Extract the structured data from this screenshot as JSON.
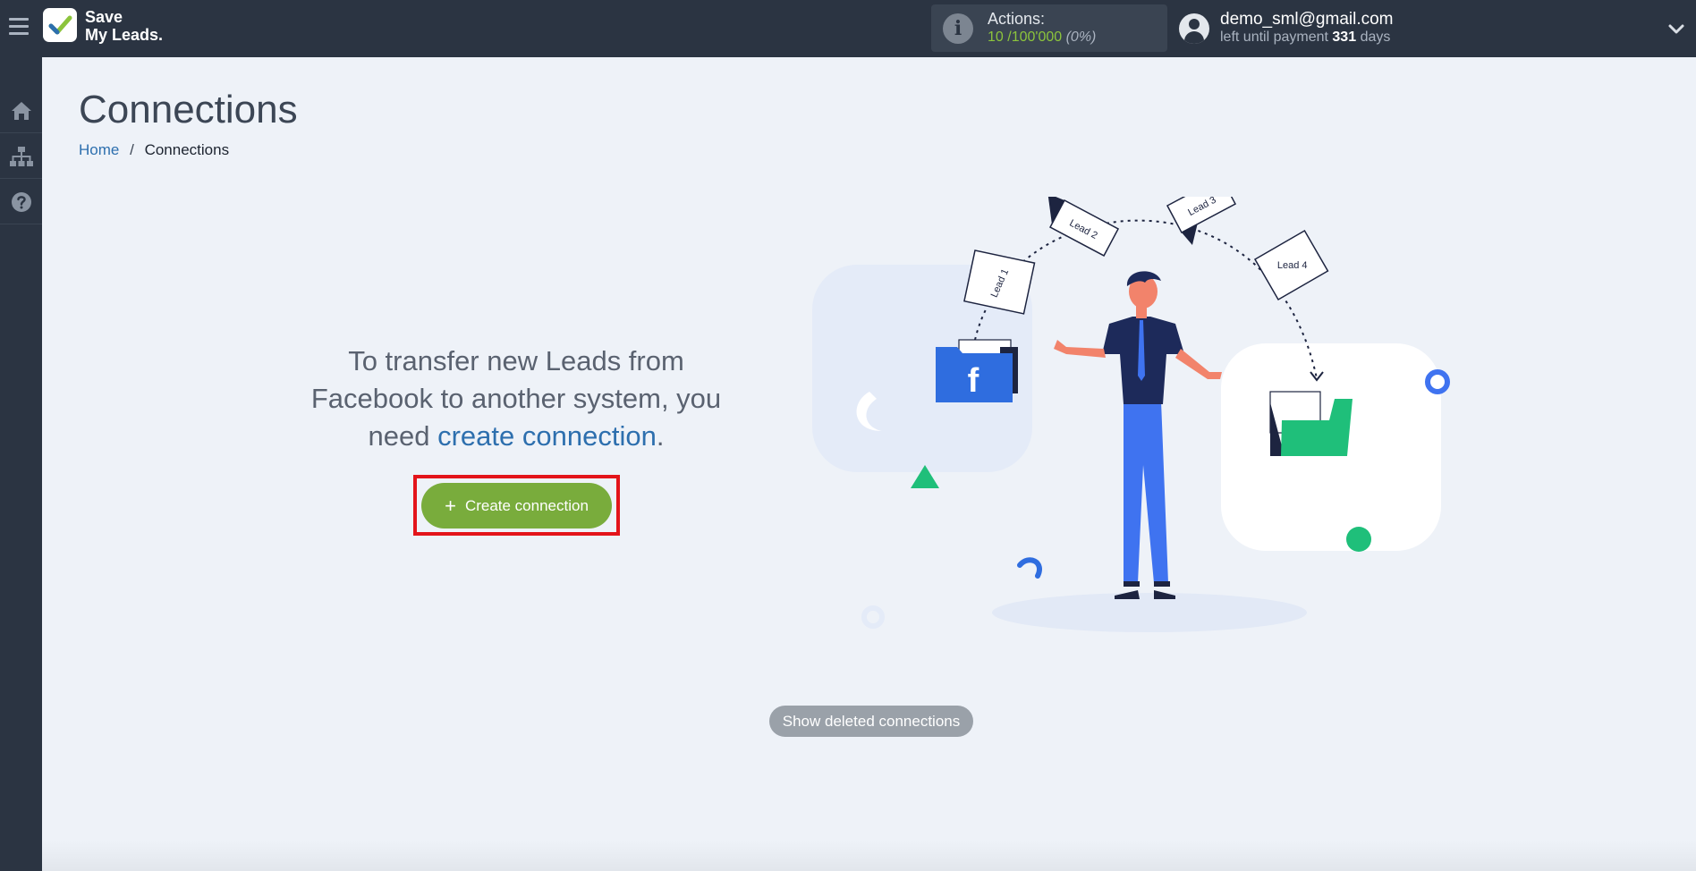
{
  "brand": {
    "name_line1": "Save",
    "name_line2": "My Leads."
  },
  "actions": {
    "label": "Actions:",
    "used": "10",
    "total": "/100'000",
    "percent": "(0%)"
  },
  "user": {
    "email": "demo_sml@gmail.com",
    "payment_prefix": "left until payment",
    "days": "331",
    "days_suffix": "days"
  },
  "sidebar": {
    "items": [
      {
        "name": "home",
        "icon": "home-icon"
      },
      {
        "name": "connections",
        "icon": "sitemap-icon"
      },
      {
        "name": "help",
        "icon": "question-icon"
      }
    ]
  },
  "page": {
    "title": "Connections"
  },
  "breadcrumb": {
    "home": "Home",
    "separator": "/",
    "current": "Connections"
  },
  "promo": {
    "text_before": "To transfer new Leads from Facebook to another system, you need ",
    "link": "create connection",
    "text_after": "."
  },
  "cta": {
    "plus": "+",
    "label": "Create connection"
  },
  "deleted": {
    "label": "Show deleted connections"
  },
  "illustration": {
    "leads": [
      "Lead 1",
      "Lead 2",
      "Lead 3",
      "Lead 4"
    ],
    "source_letter": "f"
  },
  "colors": {
    "topbar": "#2b3442",
    "accent_green": "#79ac3c",
    "link_blue": "#2d6fae",
    "highlight_red": "#e3141a"
  }
}
